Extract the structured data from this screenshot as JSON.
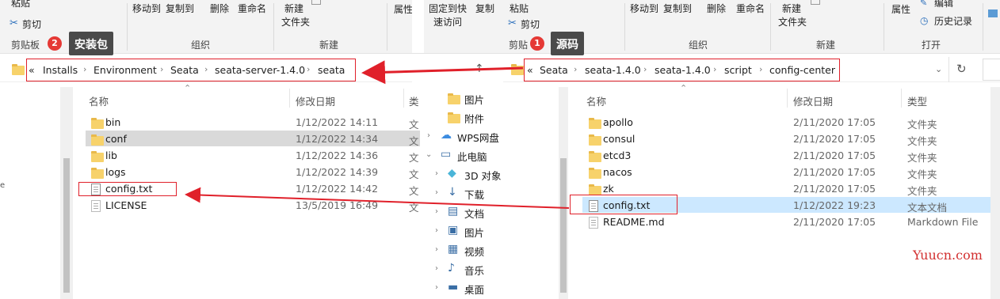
{
  "left": {
    "ribbon": {
      "paste": "粘贴",
      "cut": "剪切",
      "clipboard_group": "剪贴板",
      "move_to": "移动到",
      "copy_to": "复制到",
      "delete": "删除",
      "rename": "重命名",
      "organize_group": "组织",
      "new_folder_l1": "新建",
      "new_folder_l2": "文件夹",
      "new_group": "新建",
      "properties": "属性"
    },
    "annotation": {
      "badge": "2",
      "label": "安装包"
    },
    "address": {
      "prefix": "«",
      "crumbs": [
        "Installs",
        "Environment",
        "Seata",
        "seata-server-1.4.0",
        "seata"
      ]
    },
    "columns": {
      "name": "名称",
      "date": "修改日期",
      "type": "类"
    },
    "files": [
      {
        "name": "bin",
        "date": "1/12/2022 14:11",
        "type": "文",
        "icon": "folder"
      },
      {
        "name": "conf",
        "date": "1/12/2022 14:34",
        "type": "文",
        "icon": "folder"
      },
      {
        "name": "lib",
        "date": "1/12/2022 14:36",
        "type": "文",
        "icon": "folder"
      },
      {
        "name": "logs",
        "date": "1/12/2022 14:39",
        "type": "文",
        "icon": "folder"
      },
      {
        "name": "config.txt",
        "date": "1/12/2022 14:42",
        "type": "文",
        "icon": "text-file"
      },
      {
        "name": "LICENSE",
        "date": "13/5/2019 16:49",
        "type": "文",
        "icon": "file"
      }
    ],
    "edge_char": "e"
  },
  "nav": {
    "items": [
      {
        "label": "图片",
        "icon": "folder"
      },
      {
        "label": "附件",
        "icon": "folder"
      },
      {
        "label": "WPS网盘",
        "icon": "cloud"
      },
      {
        "label": "此电脑",
        "icon": "computer"
      },
      {
        "label": "3D 对象",
        "icon": "cube"
      },
      {
        "label": "下载",
        "icon": "download"
      },
      {
        "label": "文档",
        "icon": "document"
      },
      {
        "label": "图片",
        "icon": "picture"
      },
      {
        "label": "视频",
        "icon": "video"
      },
      {
        "label": "音乐",
        "icon": "music"
      },
      {
        "label": "桌面",
        "icon": "desktop"
      }
    ]
  },
  "right": {
    "ribbon": {
      "pin_l1": "固定到快",
      "pin_l2": "速访问",
      "copy": "复制",
      "paste": "粘贴",
      "cut": "剪切",
      "clipboard_group": "剪贴",
      "move_to": "移动到",
      "copy_to": "复制到",
      "delete": "删除",
      "rename": "重命名",
      "organize_group": "组织",
      "new_folder_l1": "新建",
      "new_folder_l2": "文件夹",
      "new_group": "新建",
      "properties": "属性",
      "edit": "编辑",
      "history": "历史记录",
      "open_group": "打开"
    },
    "annotation": {
      "badge": "1",
      "label": "源码"
    },
    "address": {
      "prefix": "«",
      "crumbs": [
        "Seata",
        "seata-1.4.0",
        "seata-1.4.0",
        "script",
        "config-center"
      ]
    },
    "columns": {
      "name": "名称",
      "date": "修改日期",
      "type": "类型"
    },
    "files": [
      {
        "name": "apollo",
        "date": "2/11/2020 17:05",
        "type": "文件夹",
        "icon": "folder"
      },
      {
        "name": "consul",
        "date": "2/11/2020 17:05",
        "type": "文件夹",
        "icon": "folder"
      },
      {
        "name": "etcd3",
        "date": "2/11/2020 17:05",
        "type": "文件夹",
        "icon": "folder"
      },
      {
        "name": "nacos",
        "date": "2/11/2020 17:05",
        "type": "文件夹",
        "icon": "folder"
      },
      {
        "name": "zk",
        "date": "2/11/2020 17:05",
        "type": "文件夹",
        "icon": "folder"
      },
      {
        "name": "config.txt",
        "date": "1/12/2022 19:23",
        "type": "文本文档",
        "icon": "text-file"
      },
      {
        "name": "README.md",
        "date": "2/11/2020 17:05",
        "type": "Markdown File",
        "icon": "markdown-file"
      }
    ]
  },
  "watermark": "Yuucn.com",
  "colors": {
    "annotation_red": "#e0202a",
    "selected_row": "#cce8ff",
    "badge": "#e53935"
  }
}
